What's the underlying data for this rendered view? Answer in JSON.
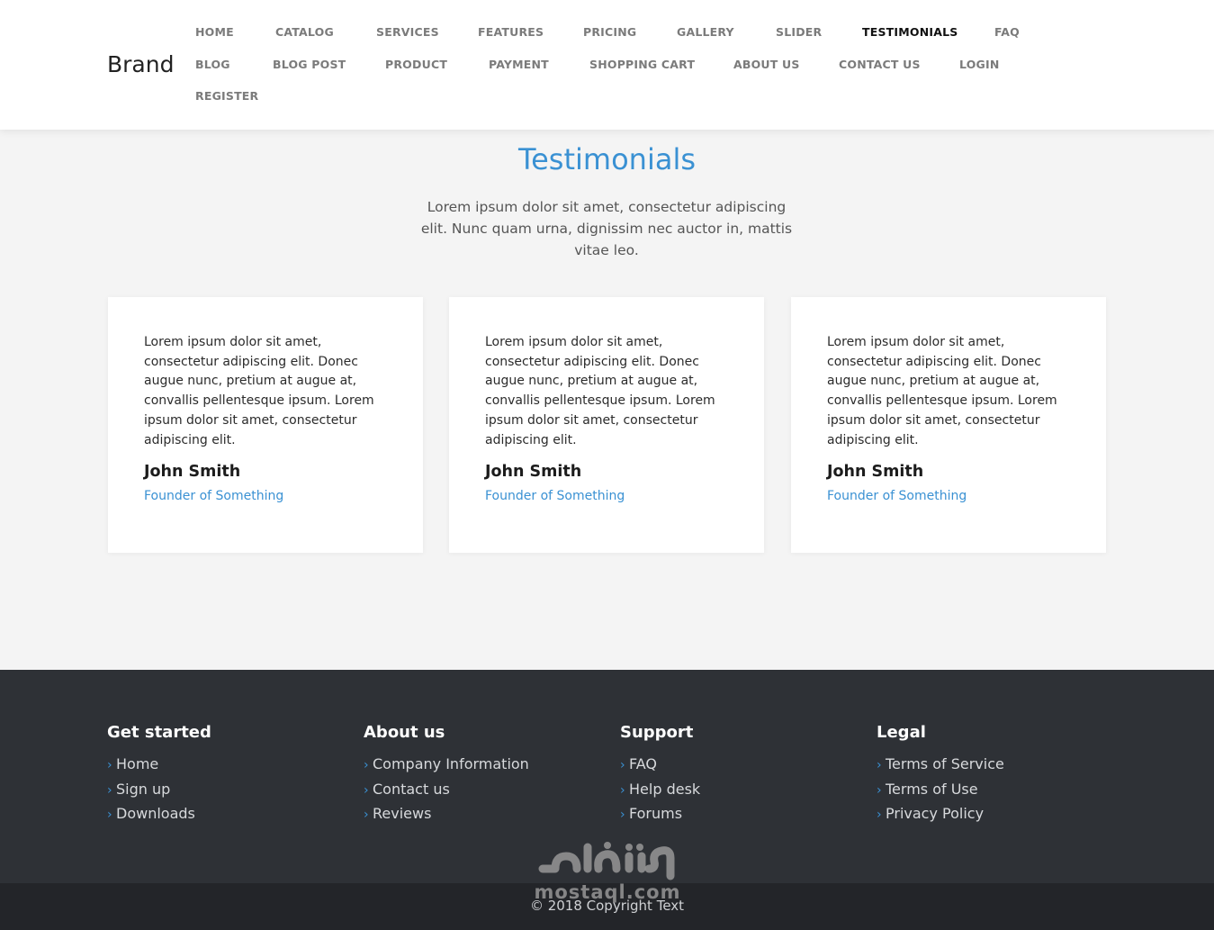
{
  "brand": "Brand",
  "nav": {
    "items": [
      {
        "label": "HOME"
      },
      {
        "label": "CATALOG"
      },
      {
        "label": "SERVICES"
      },
      {
        "label": "FEATURES"
      },
      {
        "label": "PRICING"
      },
      {
        "label": "GALLERY"
      },
      {
        "label": "SLIDER"
      },
      {
        "label": "TESTIMONIALS",
        "active": true
      },
      {
        "label": "FAQ"
      },
      {
        "label": "BLOG"
      },
      {
        "label": "BLOG POST"
      },
      {
        "label": "PRODUCT"
      },
      {
        "label": "PAYMENT"
      },
      {
        "label": "SHOPPING CART"
      },
      {
        "label": "ABOUT US"
      },
      {
        "label": "CONTACT US"
      },
      {
        "label": "LOGIN"
      },
      {
        "label": "REGISTER"
      }
    ]
  },
  "testimonials": {
    "title": "Testimonials",
    "intro": "Lorem ipsum dolor sit amet, consectetur adipiscing elit. Nunc quam urna, dignissim nec auctor in, mattis vitae leo.",
    "cards": [
      {
        "quote": "Lorem ipsum dolor sit amet, consectetur adipiscing elit. Donec augue nunc, pretium at augue at, convallis pellentesque ipsum. Lorem ipsum dolor sit amet, consectetur adipiscing elit.",
        "name": "John Smith",
        "role": "Founder of Something"
      },
      {
        "quote": "Lorem ipsum dolor sit amet, consectetur adipiscing elit. Donec augue nunc, pretium at augue at, convallis pellentesque ipsum. Lorem ipsum dolor sit amet, consectetur adipiscing elit.",
        "name": "John Smith",
        "role": "Founder of Something"
      },
      {
        "quote": "Lorem ipsum dolor sit amet, consectetur adipiscing elit. Donec augue nunc, pretium at augue at, convallis pellentesque ipsum. Lorem ipsum dolor sit amet, consectetur adipiscing elit.",
        "name": "John Smith",
        "role": "Founder of Something"
      }
    ]
  },
  "footer": {
    "columns": [
      {
        "title": "Get started",
        "links": [
          "Home",
          "Sign up",
          "Downloads"
        ]
      },
      {
        "title": "About us",
        "links": [
          "Company Information",
          "Contact us",
          "Reviews"
        ]
      },
      {
        "title": "Support",
        "links": [
          "FAQ",
          "Help desk",
          "Forums"
        ]
      },
      {
        "title": "Legal",
        "links": [
          "Terms of Service",
          "Terms of Use",
          "Privacy Policy"
        ]
      }
    ],
    "copyright": "© 2018 Copyright Text"
  },
  "watermark": {
    "text": "mostaql.com"
  },
  "colors": {
    "accent": "#3a91d3",
    "footer_bg": "#2e3136",
    "copyright_bg": "#232529"
  }
}
